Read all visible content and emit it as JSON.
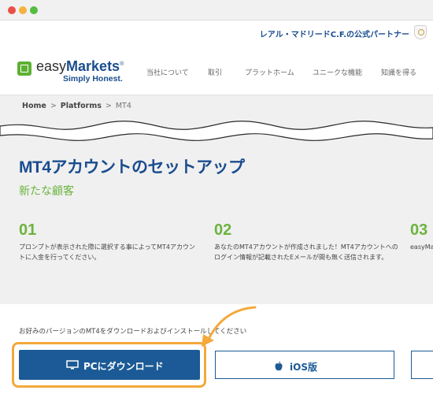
{
  "partner": {
    "text": "レアル・マドリードC.F.の公式パートナー"
  },
  "logo": {
    "brand_plain": "easy",
    "brand_bold": "Markets",
    "reg": "®",
    "tagline": "Simply Honest."
  },
  "nav": {
    "items": [
      {
        "label": "当社について"
      },
      {
        "label": "取引"
      },
      {
        "label": "プラットホーム"
      },
      {
        "label": "ユニークな機能"
      },
      {
        "label": "知識を得る"
      }
    ]
  },
  "breadcrumb": {
    "home": "Home",
    "platforms": "Platforms",
    "current": "MT4",
    "separator": ">"
  },
  "page": {
    "title": "MT4アカウントのセットアップ",
    "subtitle": "新たな顧客"
  },
  "steps": [
    {
      "number": "01",
      "text": "プロンプトが表示された際に選択する事によってMT4アカウントに入金を行ってください。"
    },
    {
      "number": "02",
      "text": "あなたのMT4アカウントが作成されました！MT4アカウントへのログイン情報が記載されたEメールが間も無く送信されます。"
    },
    {
      "number": "03",
      "text": "easyMaをダウ"
    }
  ],
  "download": {
    "instruction": "お好みのバージョンのMT4をダウンロードおよびインストールしてください",
    "pc_label": "PCにダウンロード",
    "ios_label": "iOS版"
  },
  "colors": {
    "brand_blue": "#1b5a96",
    "brand_green": "#6cb33f",
    "highlight_orange": "#f3a93c"
  },
  "icons": {
    "pc": "monitor-icon",
    "ios": "apple-icon",
    "crest": "real-madrid-crest-icon"
  }
}
